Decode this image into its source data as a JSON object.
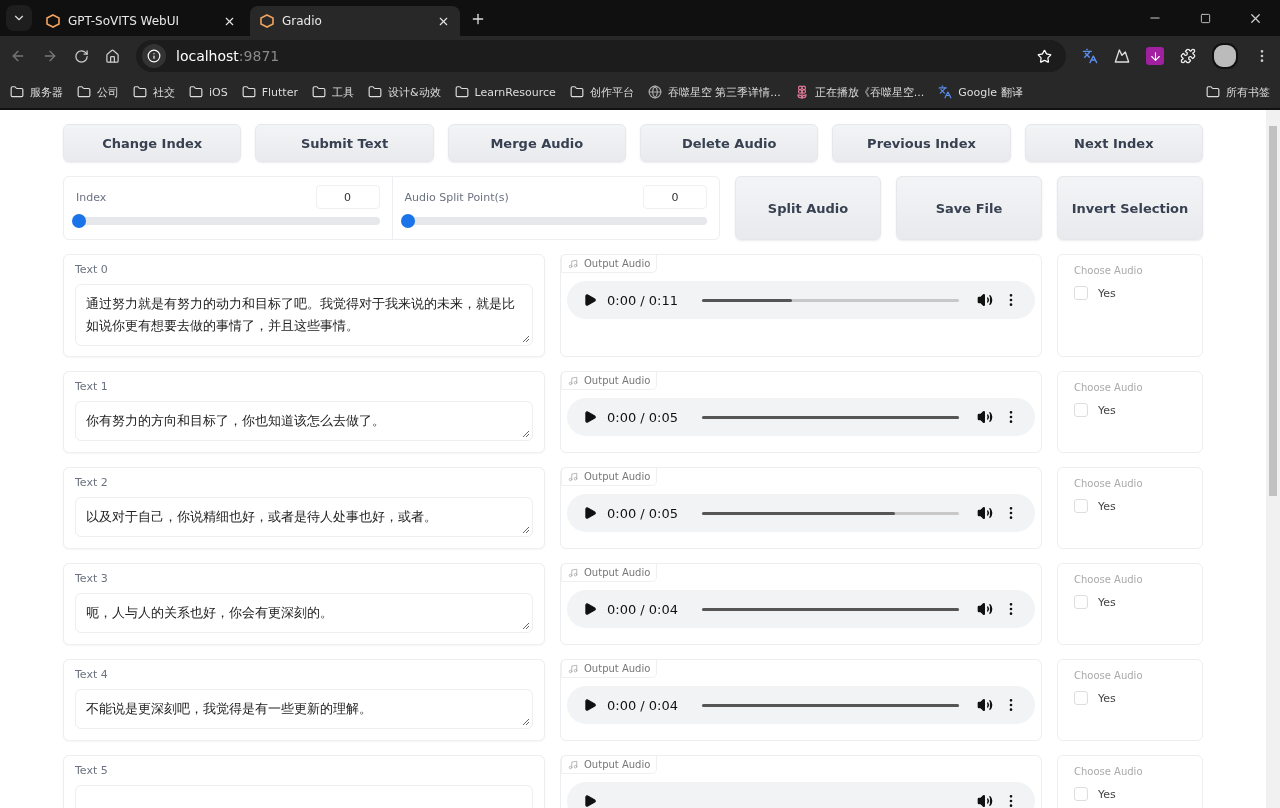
{
  "browser": {
    "tabs": [
      {
        "title": "GPT-SoVITS WebUI",
        "selected": false
      },
      {
        "title": "Gradio",
        "selected": true
      }
    ],
    "address": {
      "host": "localhost",
      "port": ":9871"
    },
    "bookmarks": [
      {
        "label": "服务器",
        "kind": "folder"
      },
      {
        "label": "公司",
        "kind": "folder"
      },
      {
        "label": "社交",
        "kind": "folder"
      },
      {
        "label": "iOS",
        "kind": "folder"
      },
      {
        "label": "Flutter",
        "kind": "folder"
      },
      {
        "label": "工具",
        "kind": "folder"
      },
      {
        "label": "设计&动效",
        "kind": "folder"
      },
      {
        "label": "LearnResource",
        "kind": "folder"
      },
      {
        "label": "创作平台",
        "kind": "folder"
      },
      {
        "label": "吞噬星空 第三季详情...",
        "kind": "globe"
      },
      {
        "label": "正在播放《吞噬星空...",
        "kind": "flower"
      },
      {
        "label": "Google 翻译",
        "kind": "translate"
      }
    ],
    "all_bookmarks": "所有书签"
  },
  "top_buttons": [
    "Change Index",
    "Submit Text",
    "Merge Audio",
    "Delete Audio",
    "Previous Index",
    "Next Index"
  ],
  "sliders": [
    {
      "label": "Index",
      "value": "0",
      "level": 0
    },
    {
      "label": "Audio Split Point(s)",
      "value": "0",
      "level": 0
    }
  ],
  "action_buttons": [
    "Split Audio",
    "Save File",
    "Invert Selection"
  ],
  "rows": [
    {
      "label": "Text 0",
      "text": "通过努力就是有努力的动力和目标了吧。我觉得对于我来说的未来，就是比如说你更有想要去做的事情了，并且这些事情。",
      "audio_label": "Output Audio",
      "time": "0:00 / 0:11",
      "level": 0.35,
      "choose_label": "Choose Audio",
      "option": "Yes",
      "checked": false
    },
    {
      "label": "Text 1",
      "text": "你有努力的方向和目标了，你也知道该怎么去做了。",
      "audio_label": "Output Audio",
      "time": "0:00 / 0:05",
      "level": 1,
      "choose_label": "Choose Audio",
      "option": "Yes",
      "checked": false
    },
    {
      "label": "Text 2",
      "text": "以及对于自己，你说精细也好，或者是待人处事也好，或者。",
      "audio_label": "Output Audio",
      "time": "0:00 / 0:05",
      "level": 0.75,
      "choose_label": "Choose Audio",
      "option": "Yes",
      "checked": false
    },
    {
      "label": "Text 3",
      "text": "呃，人与人的关系也好，你会有更深刻的。",
      "audio_label": "Output Audio",
      "time": "0:00 / 0:04",
      "level": 1,
      "choose_label": "Choose Audio",
      "option": "Yes",
      "checked": false
    },
    {
      "label": "Text 4",
      "text": "不能说是更深刻吧，我觉得是有一些更新的理解。",
      "audio_label": "Output Audio",
      "time": "0:00 / 0:04",
      "level": 1,
      "choose_label": "Choose Audio",
      "option": "Yes",
      "checked": false
    },
    {
      "label": "Text 5",
      "audio_label": "Output Audio",
      "choose_label": "Choose Audio",
      "option": "Yes",
      "checked": false
    }
  ]
}
